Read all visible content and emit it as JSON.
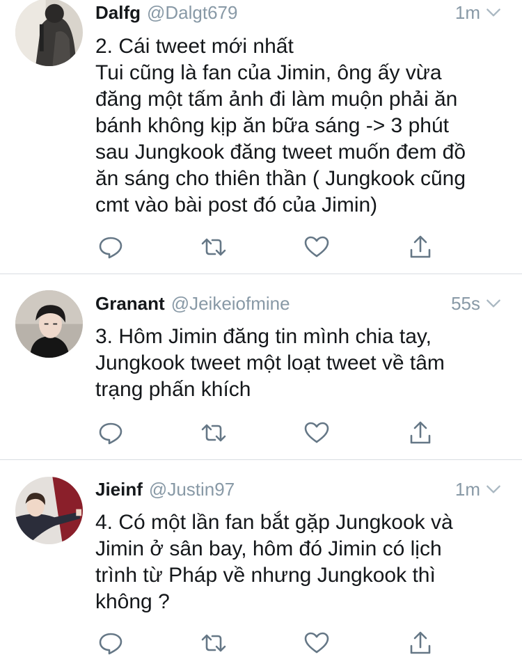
{
  "tweets": [
    {
      "name": "Dalfg",
      "handle": "@Dalgt679",
      "time": "1m",
      "lines": [
        "2. Cái tweet mới nhất",
        "Tui cũng là fan của Jimin, ông ấy vừa",
        "đăng một tấm ảnh đi làm muộn phải ăn",
        "bánh không kịp ăn bữa sáng -> 3 phút",
        "sau Jungkook đăng tweet muốn đem đồ",
        "ăn sáng cho thiên thần ( Jungkook cũng",
        "cmt vào bài post đó của Jimin)"
      ]
    },
    {
      "name": "Granant",
      "handle": "@Jeikeiofmine",
      "time": "55s",
      "lines": [
        "3. Hôm Jimin đăng tin mình chia tay,",
        "Jungkook tweet một loạt tweet về tâm",
        "trạng phấn khích"
      ]
    },
    {
      "name": "Jieinf",
      "handle": "@Justin97",
      "time": "1m",
      "lines": [
        "4. Có một lần fan bắt gặp Jungkook và",
        "Jimin ở sân bay, hôm đó Jimin có lịch",
        "trình từ Pháp về nhưng Jungkook thì",
        "không ?"
      ]
    }
  ],
  "colors": {
    "text": "#14171a",
    "secondary": "#8899a6",
    "icon": "#657786",
    "divider": "#d8dde2"
  },
  "icons": [
    "reply-icon",
    "retweet-icon",
    "like-icon",
    "share-icon",
    "chevron-down-icon"
  ]
}
